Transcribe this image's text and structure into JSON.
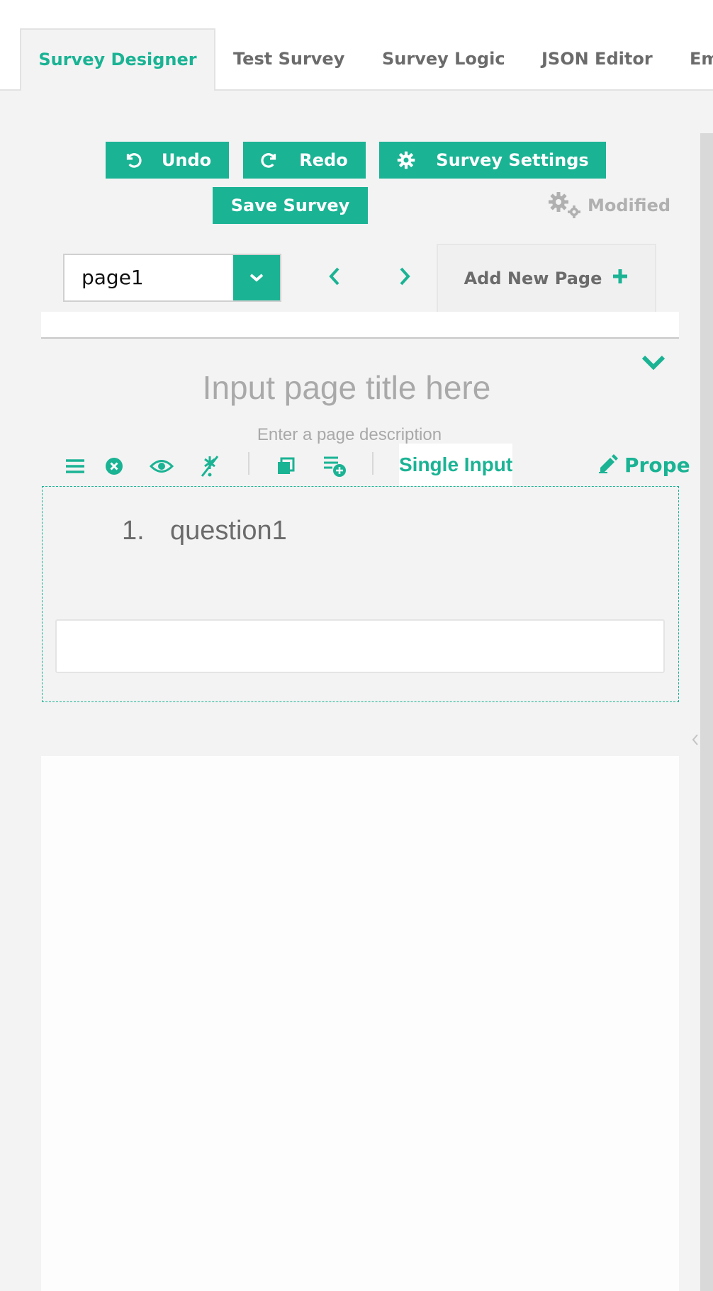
{
  "tabs": [
    {
      "label": "Survey Designer",
      "active": true
    },
    {
      "label": "Test Survey",
      "active": false
    },
    {
      "label": "Survey Logic",
      "active": false
    },
    {
      "label": "JSON Editor",
      "active": false
    },
    {
      "label": "Em",
      "active": false
    }
  ],
  "toolbar": {
    "undo_label": "Undo",
    "redo_label": "Redo",
    "settings_label": "Survey Settings",
    "save_label": "Save Survey",
    "status_label": "Modified"
  },
  "pages": {
    "selected": "page1",
    "add_label": "Add New Page"
  },
  "page": {
    "title_placeholder": "Input page title here",
    "description_placeholder": "Enter a page description"
  },
  "question_toolbar": {
    "type_label": "Single Input",
    "properties_label": "Prope"
  },
  "question": {
    "number": "1.",
    "title": "question1",
    "value": ""
  },
  "colors": {
    "accent": "#1ab394",
    "background": "#f3f3f3",
    "muted_text": "#6b6b6b",
    "placeholder_text": "#a9a9a9"
  },
  "icons": {
    "undo": "undo-icon",
    "redo": "redo-icon",
    "settings": "gear-icon",
    "status": "gears-icon",
    "dropdown": "chevron-down-icon",
    "prev": "chevron-left-icon",
    "next": "chevron-right-icon",
    "add": "plus-icon",
    "collapse": "chevron-down-icon",
    "drag": "drag-handle-icon",
    "delete": "delete-icon",
    "visibility": "eye-icon",
    "required": "required-icon",
    "copy": "copy-icon",
    "add_to_toolbox": "add-to-toolbox-icon",
    "edit": "pencil-icon"
  }
}
